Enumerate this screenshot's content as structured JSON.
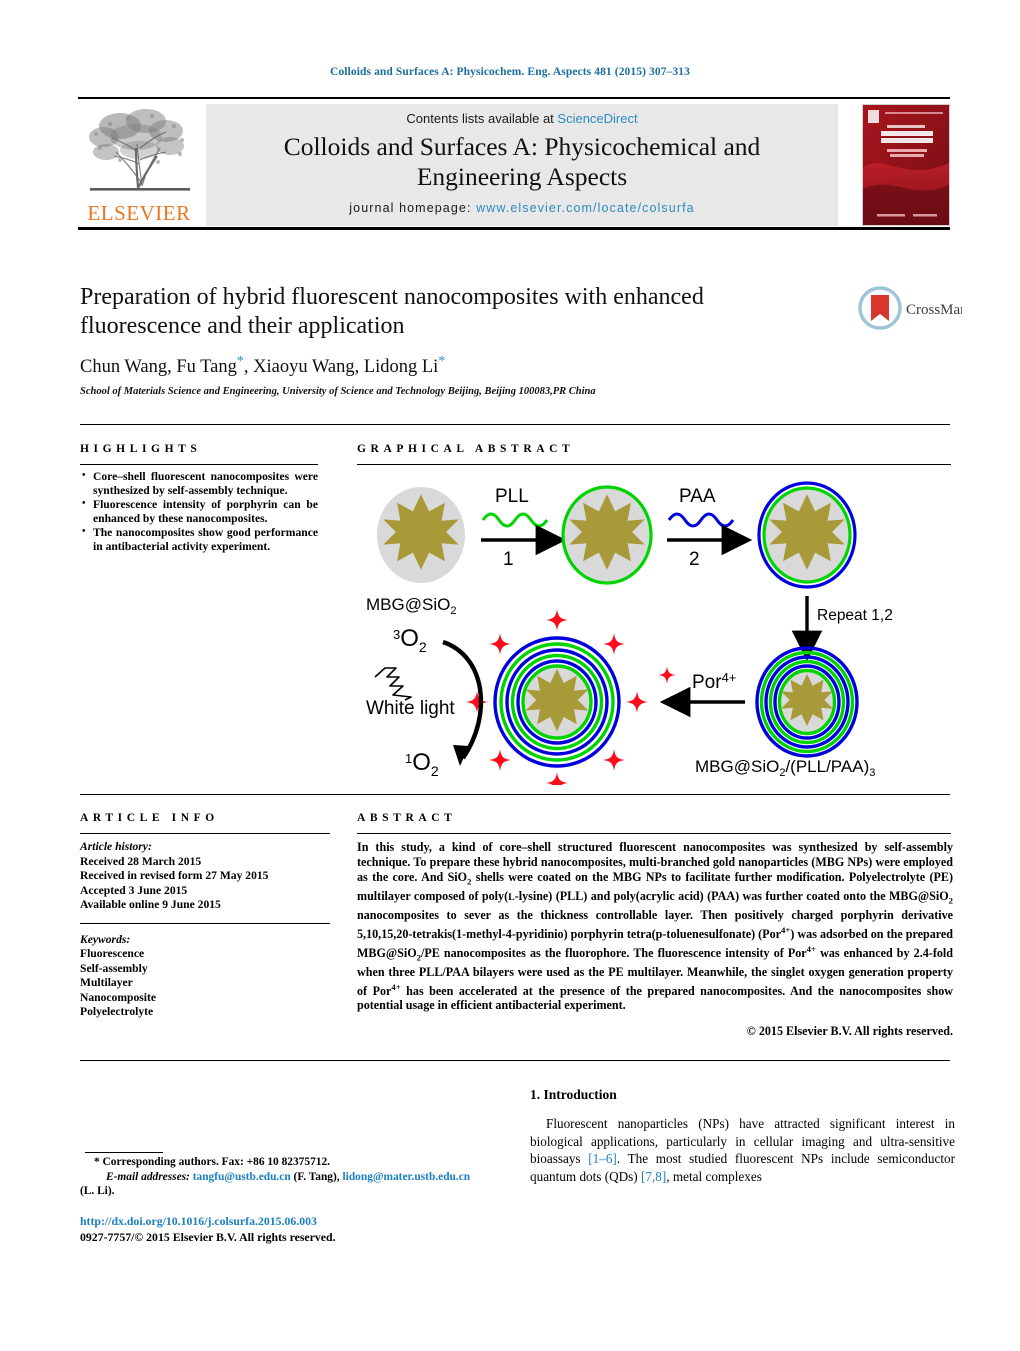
{
  "running_head": "Colloids and Surfaces A: Physicochem. Eng. Aspects 481 (2015) 307–313",
  "masthead": {
    "publisher": "ELSEVIER",
    "contents_prefix": "Contents lists available at ",
    "contents_link": "ScienceDirect",
    "journal_title_line1": "Colloids and Surfaces A: Physicochemical and",
    "journal_title_line2": "Engineering Aspects",
    "homepage_label": "journal homepage: ",
    "homepage_url": "www.elsevier.com/locate/colsurfa",
    "cover_title": "COLLOIDS AND SURFACES A",
    "cover_subtitle": "Physicochemical and engineering aspects"
  },
  "article": {
    "title": "Preparation of hybrid fluorescent nanocomposites with enhanced fluorescence and their application",
    "authors_html": "Chun Wang, Fu Tang*, Xiaoyu Wang, Lidong Li*",
    "affiliation": "School of Materials Science and Engineering, University of Science and Technology Beijing, Beijing 100083,PR China",
    "crossmark_label": "CrossMark"
  },
  "highlights": {
    "heading": "HIGHLIGHTS",
    "items": [
      "Core–shell fluorescent nanocomposites were synthesized by self-assembly technique.",
      "Fluorescence intensity of porphyrin can be enhanced by these nanocomposites.",
      "The nanocomposites show good performance in antibacterial activity experiment."
    ]
  },
  "graphical_abstract": {
    "heading": "GRAPHICAL ABSTRACT",
    "labels": {
      "start_particle": "MBG@SiO2",
      "step1_reagent": "PLL",
      "step1_number": "1",
      "step2_reagent": "PAA",
      "step2_number": "2",
      "repeat": "Repeat 1,2",
      "final_particle": "MBG@SiO2/(PLL/PAA)3",
      "porphyrin": "Por4+",
      "triplet_oxygen": "3O2",
      "singlet_oxygen": "1O2",
      "white_light": "White light"
    },
    "colors": {
      "gold_core": "#a89a38",
      "silica_shell": "#d9d9d9",
      "pll_layer": "#00d400",
      "paa_layer": "#0000dd",
      "porphyrin_star": "#fc0d1b"
    }
  },
  "article_info": {
    "heading": "ARTICLE INFO",
    "history_label": "Article history:",
    "history": [
      "Received 28 March 2015",
      "Received in revised form 27 May 2015",
      "Accepted 3 June 2015",
      "Available online 9 June 2015"
    ],
    "keywords_label": "Keywords:",
    "keywords": [
      "Fluorescence",
      "Self-assembly",
      "Multilayer",
      "Nanocomposite",
      "Polyelectrolyte"
    ]
  },
  "abstract": {
    "heading": "ABSTRACT",
    "body_html": "In this study, a kind of core–shell structured fluorescent nanocomposites was synthesized by self-assembly technique. To prepare these hybrid nanocomposites, multi-branched gold nanoparticles (MBG NPs) were employed as the core. And SiO<sub>2</sub> shells were coated on the MBG NPs to facilitate further modification. Polyelectrolyte (PE) multilayer composed of poly(<span style=\"font-size:0.82em\">L</span>-lysine) (PLL) and poly(acrylic acid) (PAA) was further coated onto the MBG@SiO<sub>2</sub> nanocomposites to sever as the thickness controllable layer. Then positively charged porphyrin derivative 5,10,15,20-tetrakis(1-methyl-4-pyridinio) porphyrin tetra(p-toluenesulfonate) (Por<sup>4+</sup>) was adsorbed on the prepared MBG@SiO<sub>2</sub>/PE nanocomposites as the fluorophore. The fluorescence intensity of Por<sup>4+</sup> was enhanced by 2.4-fold when three PLL/PAA bilayers were used as the PE multilayer. Meanwhile, the singlet oxygen generation property of Por<sup>4+</sup> has been accelerated at the presence of the prepared nanocomposites. And the nanocomposites show potential usage in efficient antibacterial experiment.",
    "copyright": "© 2015 Elsevier B.V. All rights reserved."
  },
  "introduction": {
    "heading": "1. Introduction",
    "body_html": "Fluorescent nanoparticles (NPs) have attracted significant interest in biological applications, particularly in cellular imaging and ultra-sensitive bioassays <span class=\"ref\">[1–6]</span>. The most studied fluorescent NPs include semiconductor quantum dots (QDs) <span class=\"ref\">[7,8]</span>, metal complexes"
  },
  "footer": {
    "corresponding_html": "* Corresponding authors. Fax: +86 10 82375712.",
    "email_label": "E-mail addresses:",
    "email_1": "tangfu@ustb.edu.cn",
    "email_1_owner": "(F. Tang),",
    "email_2": "lidong@mater.ustb.edu.cn",
    "email_2_owner": "(L. Li).",
    "doi_url": "http://dx.doi.org/10.1016/j.colsurfa.2015.06.003",
    "issn_line": "0927-7757/© 2015 Elsevier B.V. All rights reserved."
  }
}
